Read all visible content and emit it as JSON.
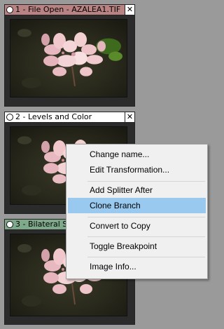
{
  "nodes": [
    {
      "title": "1 - File Open - AZALEA1.TIF",
      "close": "✕",
      "header_color": "#b98383"
    },
    {
      "title": "2 - Levels and Color",
      "close": "✕",
      "header_color": "#ffffff"
    },
    {
      "title": "3 - Bilateral Smoothing",
      "close": "✕",
      "header_color": "#7ea98a"
    }
  ],
  "context_menu": {
    "items": [
      {
        "label": "Change name..."
      },
      {
        "label": "Edit Transformation..."
      },
      {
        "label": "Add Splitter After"
      },
      {
        "label": "Clone Branch",
        "highlighted": true
      },
      {
        "label": "Convert to Copy"
      },
      {
        "label": "Toggle Breakpoint"
      },
      {
        "label": "Image Info..."
      }
    ],
    "highlight_color": "#99c9ef"
  }
}
